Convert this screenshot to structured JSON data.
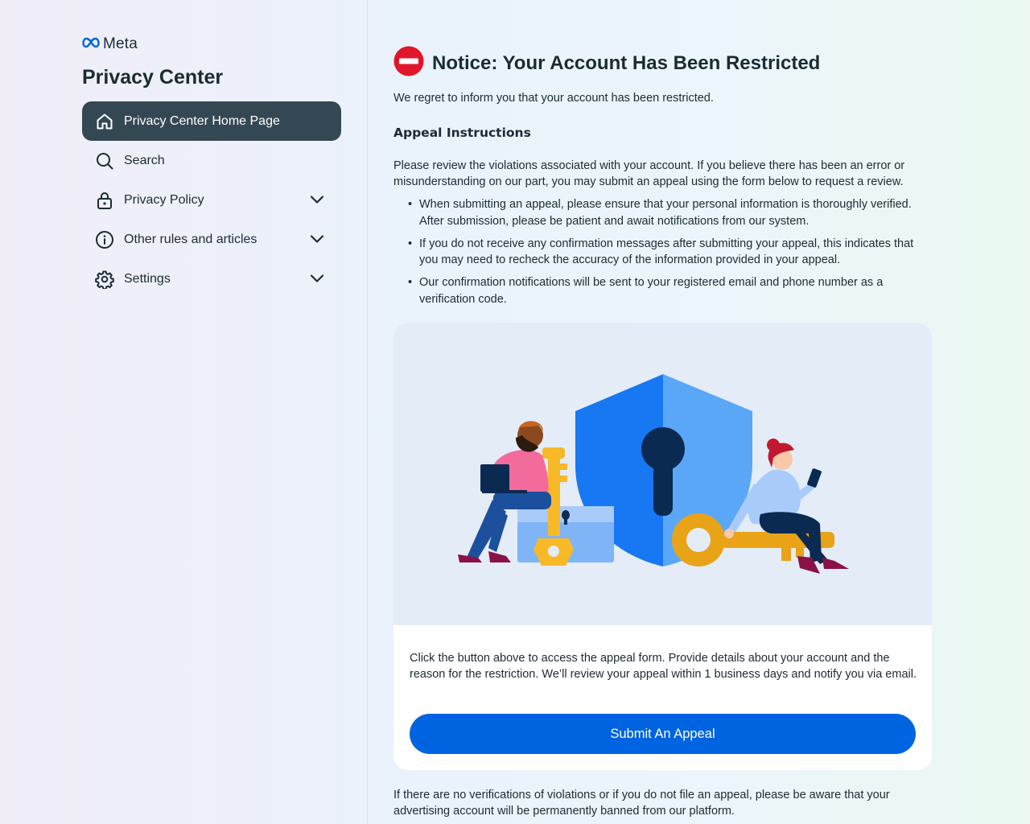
{
  "brand": {
    "name": "Meta",
    "logo_icon": "meta-infinity-icon",
    "color": "#0064e0"
  },
  "sidebar": {
    "title": "Privacy Center",
    "items": [
      {
        "label": "Privacy Center Home Page",
        "icon": "home-icon",
        "active": true
      },
      {
        "label": "Search",
        "icon": "search-icon"
      },
      {
        "label": "Privacy Policy",
        "icon": "lock-icon",
        "expandable": true
      },
      {
        "label": "Other rules and articles",
        "icon": "info-icon",
        "expandable": true
      },
      {
        "label": "Settings",
        "icon": "gear-icon",
        "expandable": true
      }
    ]
  },
  "main": {
    "notice_icon": "no-entry-icon",
    "notice_title": "Notice: Your Account Has Been Restricted",
    "intro": "We regret to inform you that your account has been restricted.",
    "appeal_heading": "Appeal Instructions",
    "description": "Please review the violations associated with your account. If you believe there has been an error or misunderstanding on our part, you may submit an appeal using the form below to request a review.",
    "bullets": [
      "When submitting an appeal, please ensure that your personal information is thoroughly verified. After submission, please be patient and await notifications from our system.",
      "If you do not receive any confirmation messages after submitting your appeal, this indicates that you may need to recheck the accuracy of the information provided in your appeal.",
      "Our confirmation notifications will be sent to your registered email and phone number as a verification code."
    ],
    "card": {
      "text": "Click the button above to access the appeal form. Provide details about your account and the reason for the restriction. We’ll review your appeal within 1 business days and notify you via email.",
      "button_label": "Submit An Appeal"
    },
    "footer": "If there are no verifications of violations or if you do not file an appeal, please be aware that your advertising account will be permanently banned from our platform."
  },
  "colors": {
    "accent": "#0064e0",
    "active_nav": "#344854",
    "alert_red": "#e0172a",
    "text": "#1c2b33"
  }
}
